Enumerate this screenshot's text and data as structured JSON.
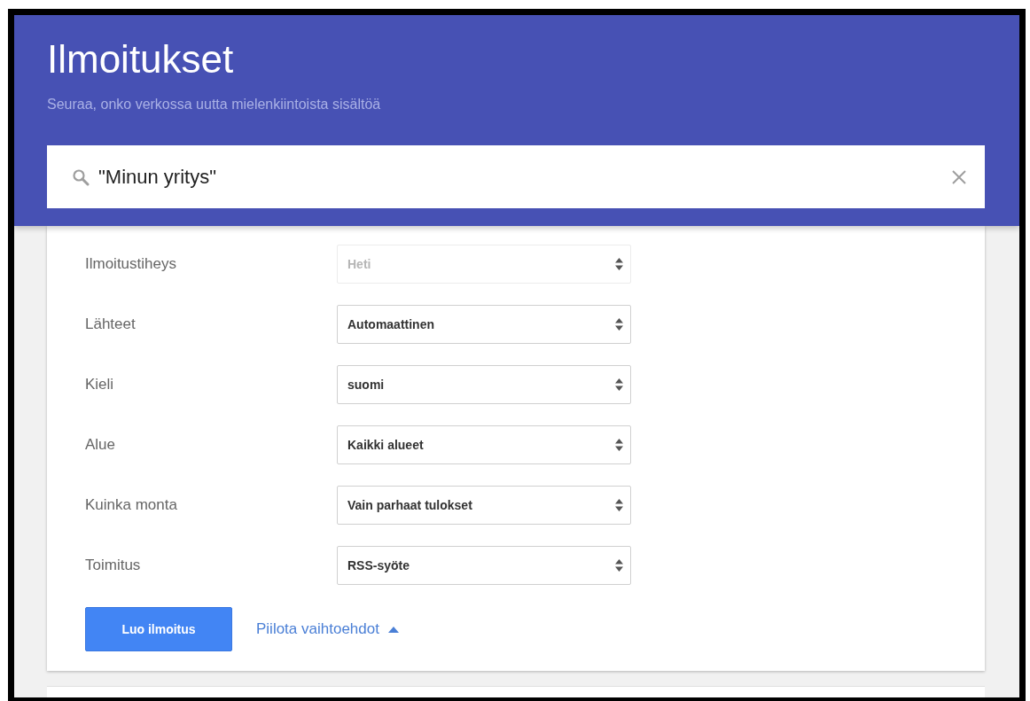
{
  "header": {
    "title": "Ilmoitukset",
    "subtitle": "Seuraa, onko verkossa uutta mielenkiintoista sisältöä"
  },
  "search": {
    "value": "\"Minun yritys\""
  },
  "options": [
    {
      "label": "Ilmoitustiheys",
      "value": "Heti",
      "disabled": true
    },
    {
      "label": "Lähteet",
      "value": "Automaattinen",
      "disabled": false
    },
    {
      "label": "Kieli",
      "value": "suomi",
      "disabled": false
    },
    {
      "label": "Alue",
      "value": "Kaikki alueet",
      "disabled": false
    },
    {
      "label": "Kuinka monta",
      "value": "Vain parhaat tulokset",
      "disabled": false
    },
    {
      "label": "Toimitus",
      "value": "RSS-syöte",
      "disabled": false
    }
  ],
  "create_button": "Luo ilmoitus",
  "toggle_link": {
    "label": "Piilota vaihtoehdot",
    "expanded": true
  }
}
